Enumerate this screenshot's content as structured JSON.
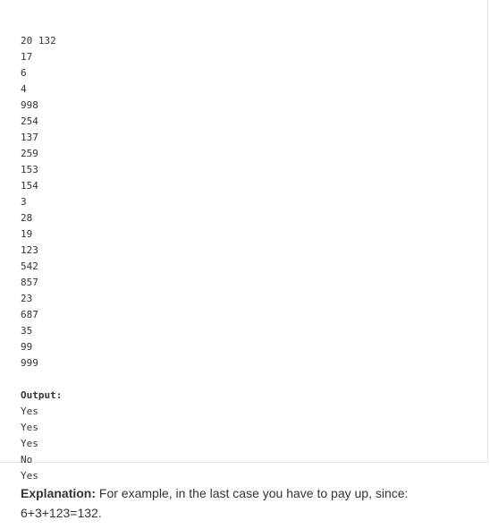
{
  "input_lines": [
    "20 132",
    "17",
    "6",
    "4",
    "998",
    "254",
    "137",
    "259",
    "153",
    "154",
    "3",
    "28",
    "19",
    "123",
    "542",
    "857",
    "23",
    "687",
    "35",
    "99",
    "999"
  ],
  "output_label": "Output:",
  "output_lines": [
    "Yes",
    "Yes",
    "Yes",
    "No",
    "Yes"
  ],
  "explanation": {
    "label": "Explanation:",
    "text": " For example, in the last case you have to pay up, since: 6+3+123=132."
  }
}
